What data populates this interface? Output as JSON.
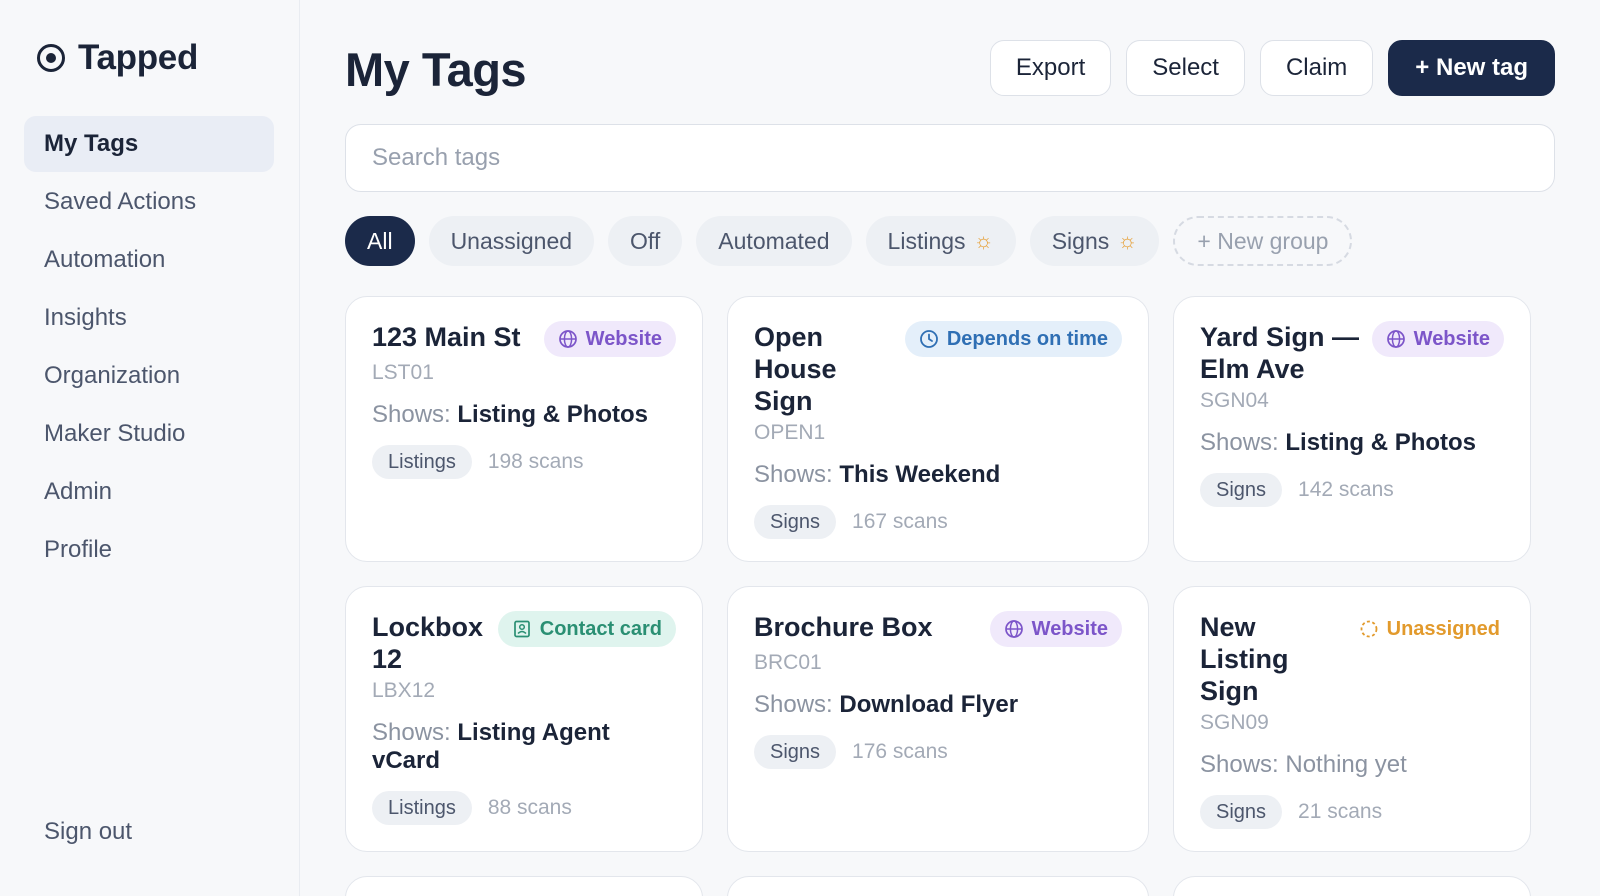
{
  "app": {
    "name": "Tapped",
    "logo_icon": "target-icon"
  },
  "sidebar": {
    "items": [
      {
        "label": "My Tags",
        "active": true
      },
      {
        "label": "Saved Actions",
        "active": false
      },
      {
        "label": "Automation",
        "active": false
      },
      {
        "label": "Insights",
        "active": false
      },
      {
        "label": "Organization",
        "active": false
      },
      {
        "label": "Maker Studio",
        "active": false
      },
      {
        "label": "Admin",
        "active": false
      },
      {
        "label": "Profile",
        "active": false
      }
    ],
    "signout_label": "Sign out"
  },
  "header": {
    "title": "My Tags",
    "export_label": "Export",
    "select_label": "Select",
    "claim_label": "Claim",
    "new_tag_label": "+ New tag"
  },
  "search": {
    "placeholder": "Search tags",
    "value": ""
  },
  "filters": {
    "all": "All",
    "unassigned": "Unassigned",
    "off": "Off",
    "automated": "Automated",
    "listings": "Listings",
    "signs": "Signs",
    "new_group": "+ New group",
    "smart_group_icon": "sun-icon"
  },
  "cards": [
    {
      "title": "123 Main St",
      "code": "LST01",
      "badge": "Website",
      "badge_type": "website",
      "shows_label": "Shows:",
      "shows_value": "Listing & Photos",
      "group": "Listings",
      "scans": "198 scans"
    },
    {
      "title": "Open House Sign",
      "code": "OPEN1",
      "badge": "Depends on time",
      "badge_type": "time",
      "shows_label": "Shows:",
      "shows_value": "This Weekend",
      "group": "Signs",
      "scans": "167 scans"
    },
    {
      "title": "Yard Sign — Elm Ave",
      "code": "SGN04",
      "badge": "Website",
      "badge_type": "website",
      "shows_label": "Shows:",
      "shows_value": "Listing & Photos",
      "group": "Signs",
      "scans": "142 scans"
    },
    {
      "title": "Lockbox 12",
      "code": "LBX12",
      "badge": "Contact card",
      "badge_type": "contact",
      "shows_label": "Shows:",
      "shows_value": "Listing Agent vCard",
      "group": "Listings",
      "scans": "88 scans"
    },
    {
      "title": "Brochure Box",
      "code": "BRC01",
      "badge": "Website",
      "badge_type": "website",
      "shows_label": "Shows:",
      "shows_value": "Download Flyer",
      "group": "Signs",
      "scans": "176 scans"
    },
    {
      "title": "New Listing Sign",
      "code": "SGN09",
      "badge": "Unassigned",
      "badge_type": "unassigned",
      "shows_label": "Shows:",
      "shows_value": "Nothing yet",
      "group": "Signs",
      "scans": "21 scans"
    }
  ],
  "colors": {
    "primary": "#1b2a4a",
    "website_badge": "#7c55c9",
    "time_badge": "#2f6fb4",
    "contact_badge": "#2a8f73",
    "unassigned_badge": "#e29a2c"
  }
}
